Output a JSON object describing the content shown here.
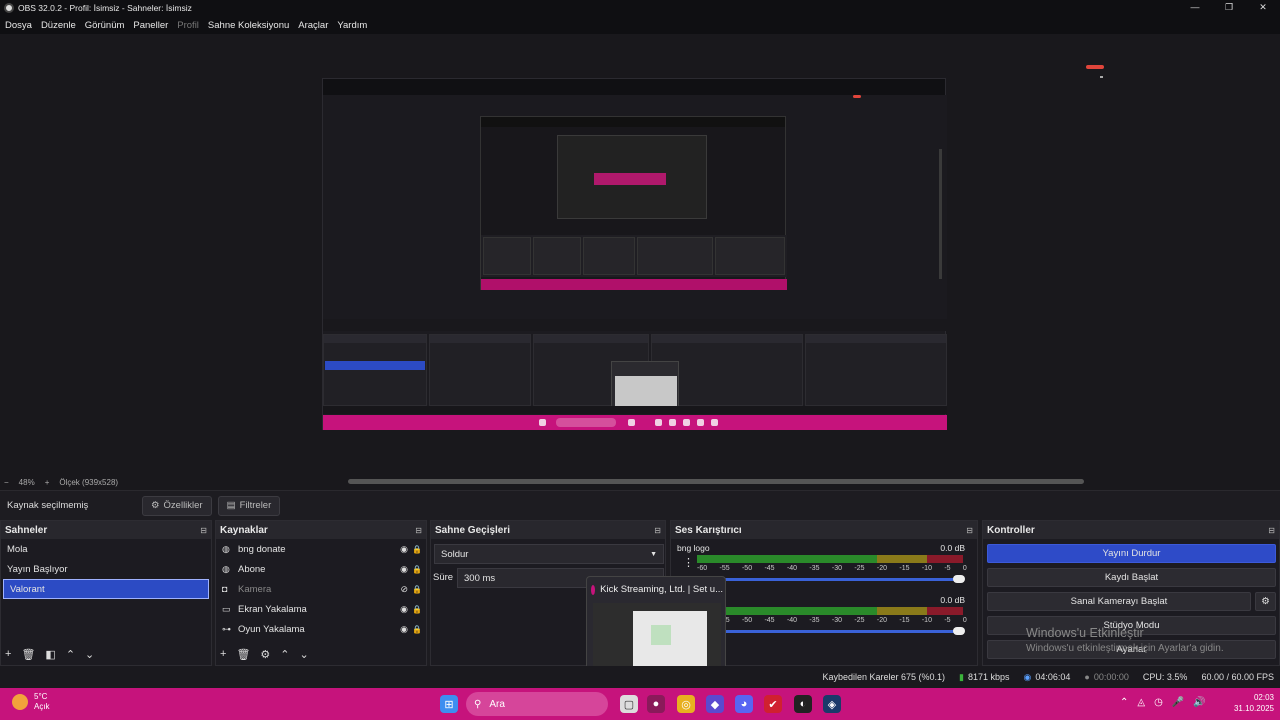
{
  "window": {
    "title": "OBS 32.0.2 - Profil: İsimsiz - Sahneler: İsimsiz"
  },
  "menu": [
    {
      "label": "Dosya",
      "dim": false
    },
    {
      "label": "Düzenle",
      "dim": false
    },
    {
      "label": "Görünüm",
      "dim": false
    },
    {
      "label": "Paneller",
      "dim": false
    },
    {
      "label": "Profil",
      "dim": true
    },
    {
      "label": "Sahne Koleksiyonu",
      "dim": false
    },
    {
      "label": "Araçlar",
      "dim": false
    },
    {
      "label": "Yardım",
      "dim": false
    }
  ],
  "zoom": {
    "minus": "−",
    "value": "48%",
    "plus": "+",
    "scale": "Ölçek (939x528)"
  },
  "source_bar": {
    "label": "Kaynak seçilmemiş",
    "properties": "Özellikler",
    "filters": "Filtreler"
  },
  "scenes": {
    "title": "Sahneler",
    "items": [
      {
        "label": "Mola"
      },
      {
        "label": "Yayın Başlıyor"
      },
      {
        "label": "Valorant",
        "selected": true
      }
    ]
  },
  "sources": {
    "title": "Kaynaklar",
    "items": [
      {
        "label": "bng donate",
        "icon": "globe-icon"
      },
      {
        "label": "Abone",
        "icon": "globe-icon"
      },
      {
        "label": "Kamera",
        "icon": "camera-icon",
        "hidden": true
      },
      {
        "label": "Ekran Yakalama",
        "icon": "monitor-icon"
      },
      {
        "label": "Oyun Yakalama",
        "icon": "gamepad-icon"
      }
    ]
  },
  "transitions": {
    "title": "Sahne Geçişleri",
    "selected": "Soldur",
    "duration_label": "Süre",
    "duration_value": "300 ms"
  },
  "mixer": {
    "title": "Ses Karıştırıcı",
    "channels": [
      {
        "name": "bng logo",
        "db": "0.0 dB"
      },
      {
        "name": "",
        "db": "0.0 dB"
      }
    ],
    "scale": [
      "-60",
      "-55",
      "-50",
      "-45",
      "-40",
      "-35",
      "-30",
      "-25",
      "-20",
      "-15",
      "-10",
      "-5",
      "0"
    ],
    "meter_colors": {
      "green": "#2a8a2a",
      "yellow": "#8a7a1a",
      "red": "#8a1a2a"
    }
  },
  "controls": {
    "title": "Kontroller",
    "buttons": [
      "Yayını Durdur",
      "Kaydı Başlat",
      "Sanal Kamerayı Başlat",
      "Stüdyo Modu",
      "Ayarlar"
    ]
  },
  "taskbar_preview": {
    "title": "Kick Streaming, Ltd. | Set u..."
  },
  "watermark": {
    "line1": "Windows'u Etkinleştir",
    "line2": "Windows'u etkinleştirmek için Ayarlar'a gidin."
  },
  "status": {
    "dropped": "Kaybedilen Kareler 675 (%0.1)",
    "bitrate": "8171 kbps",
    "stream_time": "04:06:04",
    "rec_time": "00:00:00",
    "cpu": "CPU: 3.5%",
    "fps": "60.00 / 60.00 FPS"
  },
  "taskbar": {
    "weather_temp": "5°C",
    "weather_desc": "Açık",
    "search": "Ara",
    "time": "02:03",
    "date": "31.10.2025",
    "accent": "#c6137c"
  },
  "accent_blue": "#2c4bc4"
}
